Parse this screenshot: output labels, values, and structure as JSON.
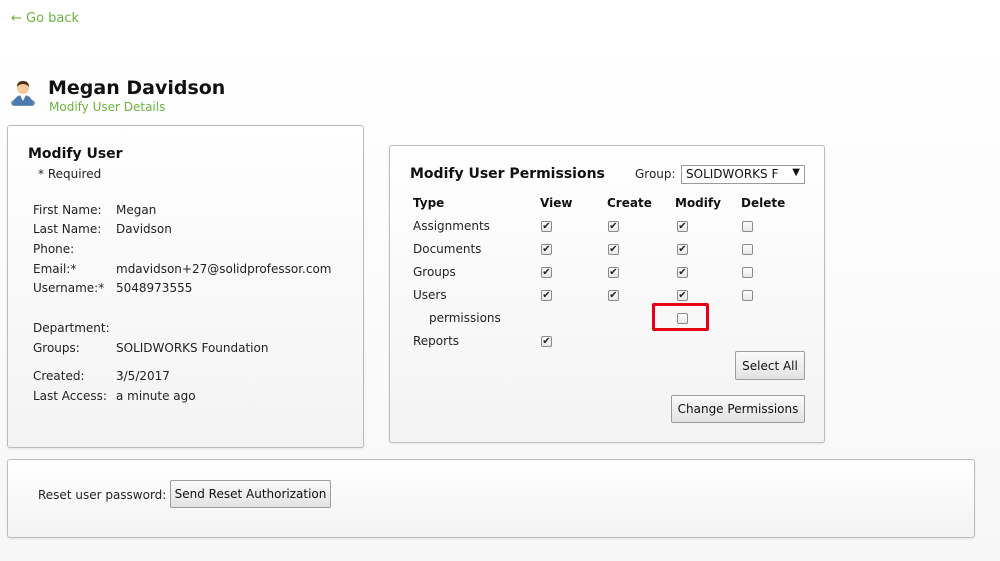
{
  "nav": {
    "back_label": "← Go back"
  },
  "header": {
    "name": "Megan Davidson",
    "subtitle": "Modify User Details"
  },
  "modify_user": {
    "title": "Modify User",
    "required_note": "* Required",
    "fields": {
      "first_name": {
        "label": "First Name:",
        "value": "Megan"
      },
      "last_name": {
        "label": "Last Name:",
        "value": "Davidson"
      },
      "phone": {
        "label": "Phone:",
        "value": ""
      },
      "email": {
        "label": "Email:*",
        "value": "mdavidson+27@solidprofessor.com"
      },
      "username": {
        "label": "Username:*",
        "value": "5048973555"
      },
      "department": {
        "label": "Department:",
        "value": ""
      },
      "groups": {
        "label": "Groups:",
        "value": "SOLIDWORKS Foundation"
      },
      "created": {
        "label": "Created:",
        "value": "3/5/2017"
      },
      "last_access": {
        "label": "Last Access:",
        "value": "a minute ago"
      }
    }
  },
  "permissions": {
    "title": "Modify User Permissions",
    "group_label": "Group:",
    "group_selected": "SOLIDWORKS F",
    "columns": {
      "type": "Type",
      "view": "View",
      "create": "Create",
      "modify": "Modify",
      "delete": "Delete"
    },
    "rows": [
      {
        "label": "Assignments",
        "view": true,
        "create": true,
        "modify": true,
        "delete": false
      },
      {
        "label": "Documents",
        "view": true,
        "create": true,
        "modify": true,
        "delete": false
      },
      {
        "label": "Groups",
        "view": true,
        "create": true,
        "modify": true,
        "delete": false
      },
      {
        "label": "Users",
        "view": true,
        "create": true,
        "modify": true,
        "delete": false
      },
      {
        "label": "permissions",
        "modify": false
      },
      {
        "label": "Reports",
        "view": true
      }
    ],
    "select_all_label": "Select All",
    "change_permissions_label": "Change Permissions",
    "highlight_color": "#e60012"
  },
  "reset": {
    "label": "Reset user password:",
    "button_label": "Send Reset Authorization"
  },
  "colors": {
    "accent_green": "#6db33f"
  }
}
